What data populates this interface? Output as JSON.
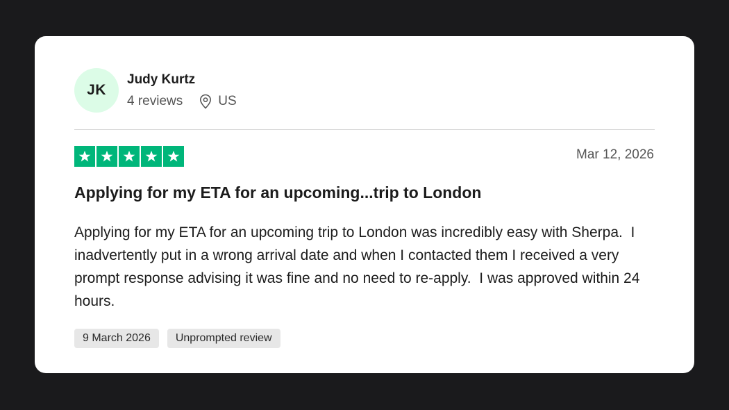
{
  "reviewer": {
    "initials": "JK",
    "name": "Judy Kurtz",
    "review_count": "4 reviews",
    "country": "US",
    "location_icon": "map-pin-icon",
    "avatar_color": "#dcfce7"
  },
  "review": {
    "rating": 5,
    "rating_max": 5,
    "star_icon": "star-icon",
    "star_color": "#00b67a",
    "date": "Mar 12, 2026",
    "title": "Applying for my ETA for an upcoming...trip to London",
    "body": "Applying for my ETA for an upcoming trip to London was incredibly easy with Sherpa.  I inadvertently put in a wrong arrival date and when I contacted them I received a very prompt response advising it was fine and no need to re-apply.  I was approved within 24 hours."
  },
  "tags": {
    "experience_date": "9 March 2026",
    "review_type": "Unprompted review"
  }
}
